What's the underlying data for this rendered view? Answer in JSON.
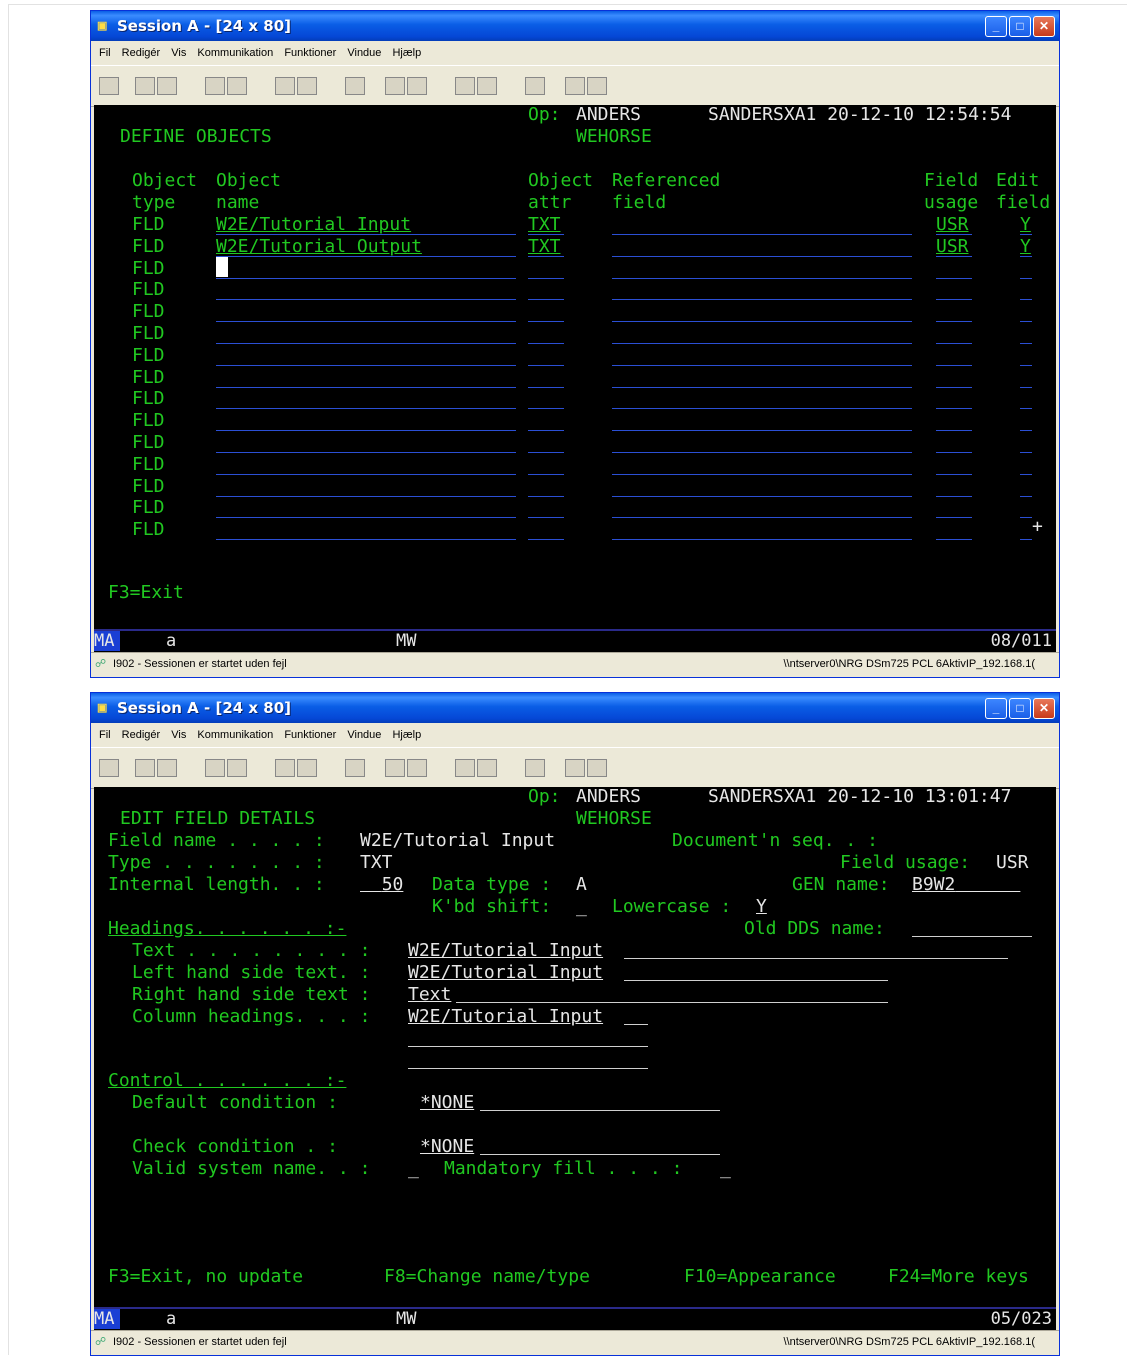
{
  "window_title": "Session A - [24 x 80]",
  "menu": [
    "Fil",
    "Redigér",
    "Vis",
    "Kommunikation",
    "Funktioner",
    "Vindue",
    "Hjælp"
  ],
  "statusbar": {
    "left": "I902 - Sessionen er startet uden fejl",
    "right": "\\\\ntserver0\\NRG DSm725 PCL 6AktivIP_192.168.1("
  },
  "screen1": {
    "op_label": "Op:",
    "user": "ANDERS",
    "system_line": "SANDERSXA1 20-12-10 12:54:54",
    "env": "WEHORSE",
    "title": "DEFINE OBJECTS",
    "headers": {
      "object_type_1": "Object",
      "object_type_2": "type",
      "object_name_1": "Object",
      "object_name_2": "name",
      "object_attr_1": "Object",
      "object_attr_2": "attr",
      "ref_field_1": "Referenced",
      "ref_field_2": "field",
      "field_usage_1": "Field",
      "field_usage_2": "usage",
      "edit_field_1": "Edit",
      "edit_field_2": "field"
    },
    "rows": [
      {
        "type": "FLD",
        "name": "W2E/Tutorial Input",
        "attr": "TXT",
        "usage": "USR",
        "edit": "Y"
      },
      {
        "type": "FLD",
        "name": "W2E/Tutorial Output",
        "attr": "TXT",
        "usage": "USR",
        "edit": "Y"
      },
      {
        "type": "FLD"
      },
      {
        "type": "FLD"
      },
      {
        "type": "FLD"
      },
      {
        "type": "FLD"
      },
      {
        "type": "FLD"
      },
      {
        "type": "FLD"
      },
      {
        "type": "FLD"
      },
      {
        "type": "FLD"
      },
      {
        "type": "FLD"
      },
      {
        "type": "FLD"
      },
      {
        "type": "FLD"
      },
      {
        "type": "FLD"
      },
      {
        "type": "FLD"
      }
    ],
    "more": "+",
    "fkeys": "F3=Exit",
    "status": {
      "ma": "MA",
      "a": "a",
      "mw": "MW",
      "pos": "08/011"
    }
  },
  "screen2": {
    "op_label": "Op:",
    "user": "ANDERS",
    "system_line": "SANDERSXA1 20-12-10 13:01:47",
    "env": "WEHORSE",
    "title": "EDIT FIELD DETAILS",
    "field_name_label": "Field name . . . . :",
    "field_name_value": "W2E/Tutorial Input",
    "doc_seq_label": "Document'n seq. . :",
    "type_label": "Type . . . . . . . :",
    "type_value": "TXT",
    "field_usage_label": "Field usage:",
    "field_usage_value": "USR",
    "internal_length_label": "Internal length. . :",
    "internal_length_value": "50",
    "data_type_label": "Data type :",
    "data_type_value": "A",
    "gen_name_label": "GEN name:",
    "gen_name_value": "B9W2",
    "kbd_shift_label": "K'bd shift:",
    "kbd_shift_value": "_",
    "lowercase_label": "Lowercase :",
    "lowercase_value": "Y",
    "headings_label": "Headings. . . . . . :-",
    "old_dds_label": "Old DDS name:",
    "text_label": "Text . . . . . . . . :",
    "text_value": "W2E/Tutorial Input",
    "lhs_label": "Left hand side text. :",
    "lhs_value": "W2E/Tutorial Input",
    "rhs_label": "Right hand side text :",
    "rhs_value": "Text",
    "colhead_label": "Column headings. . . :",
    "colhead_value": "W2E/Tutorial Input",
    "control_label": "Control . . . . . . :-",
    "default_cond_label": "Default condition :",
    "default_cond_value": "*NONE",
    "check_cond_label": "Check condition . :",
    "check_cond_value": "*NONE",
    "valid_sys_label": "Valid system name. . :",
    "valid_sys_value": "_",
    "mandatory_label": "Mandatory fill . . . :",
    "mandatory_value": "_",
    "fkeys": [
      "F3=Exit, no update",
      "F8=Change name/type",
      "F10=Appearance",
      "F24=More keys"
    ],
    "status": {
      "ma": "MA",
      "a": "a",
      "mw": "MW",
      "pos": "05/023"
    }
  }
}
